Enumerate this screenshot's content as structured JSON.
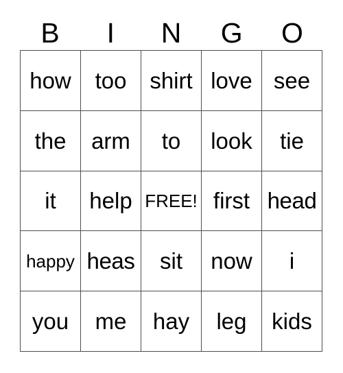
{
  "card": {
    "title": "BINGO",
    "header": {
      "letters": [
        "B",
        "I",
        "N",
        "G",
        "O"
      ]
    },
    "grid": {
      "rows": 5,
      "columns": 5,
      "border_color": "#4d4d4d",
      "background_color": "#ffffff",
      "text_color": "#000000",
      "free_space": {
        "row": 3,
        "column": 3,
        "label": "FREE!"
      },
      "cells": [
        [
          {
            "text": "how",
            "size": "normal"
          },
          {
            "text": "too",
            "size": "normal"
          },
          {
            "text": "shirt",
            "size": "normal"
          },
          {
            "text": "love",
            "size": "normal"
          },
          {
            "text": "see",
            "size": "normal"
          }
        ],
        [
          {
            "text": "the",
            "size": "normal"
          },
          {
            "text": "arm",
            "size": "normal"
          },
          {
            "text": "to",
            "size": "normal"
          },
          {
            "text": "look",
            "size": "normal"
          },
          {
            "text": "tie",
            "size": "normal"
          }
        ],
        [
          {
            "text": "it",
            "size": "normal"
          },
          {
            "text": "help",
            "size": "normal"
          },
          {
            "text": "FREE!",
            "size": "small"
          },
          {
            "text": "first",
            "size": "normal"
          },
          {
            "text": "head",
            "size": "wide"
          }
        ],
        [
          {
            "text": "happy",
            "size": "small"
          },
          {
            "text": "heas",
            "size": "wide"
          },
          {
            "text": "sit",
            "size": "normal"
          },
          {
            "text": "now",
            "size": "normal"
          },
          {
            "text": "i",
            "size": "normal"
          }
        ],
        [
          {
            "text": "you",
            "size": "normal"
          },
          {
            "text": "me",
            "size": "normal"
          },
          {
            "text": "hay",
            "size": "normal"
          },
          {
            "text": "leg",
            "size": "normal"
          },
          {
            "text": "kids",
            "size": "normal"
          }
        ]
      ]
    }
  }
}
